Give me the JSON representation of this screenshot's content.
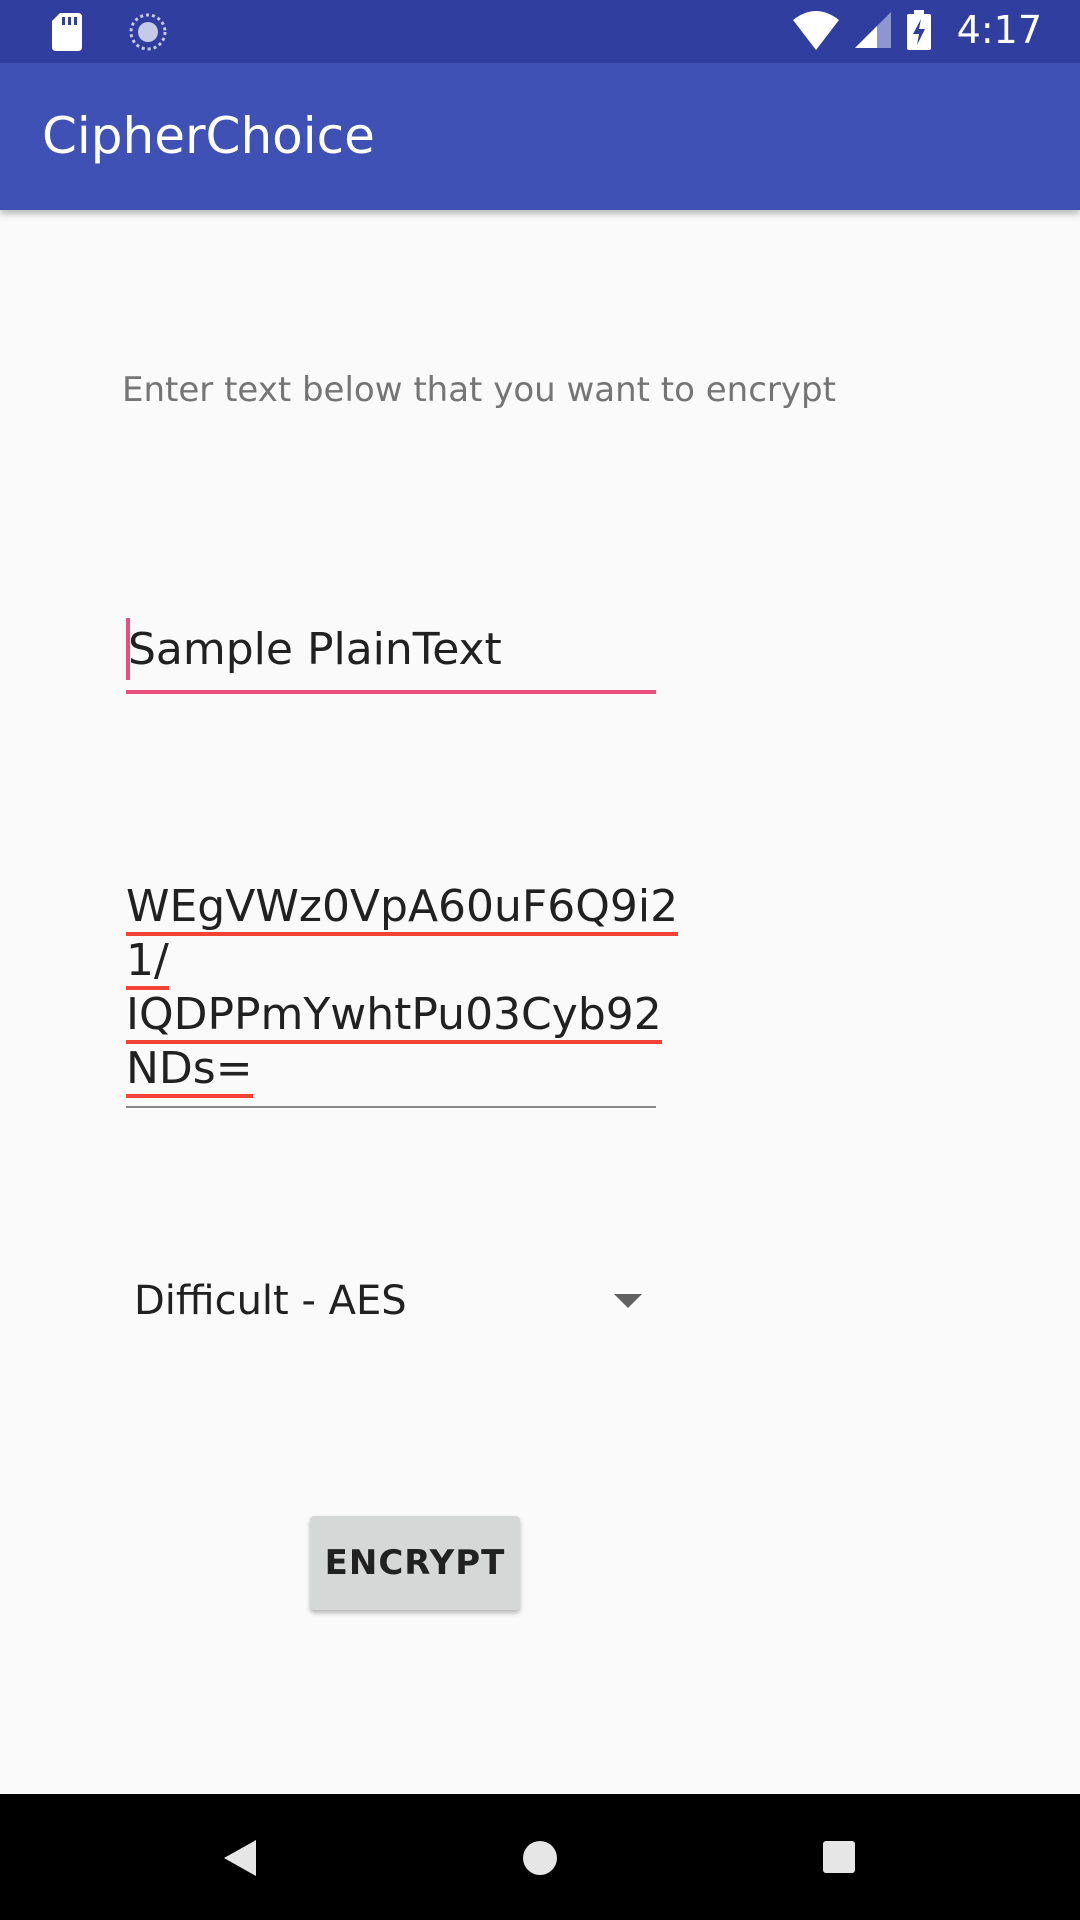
{
  "status_bar": {
    "time": "4:17",
    "icons": [
      "sd-card-icon",
      "sync-icon",
      "wifi-icon",
      "signal-icon",
      "battery-charging-icon"
    ]
  },
  "app_bar": {
    "title": "CipherChoice"
  },
  "main": {
    "prompt_label": "Enter text below that you want to encrypt",
    "plaintext_value": "Sample PlainText",
    "ciphertext_lines": [
      "WEgVWz0VpA60uF6Q9i2",
      "1/",
      "IQDPPmYwhtPu03Cyb92",
      "NDs="
    ],
    "cipher_selected": "Difficult - AES",
    "encrypt_label": "ENCRYPT"
  },
  "nav_bar": {
    "icons": [
      "back-icon",
      "home-icon",
      "recents-icon"
    ]
  },
  "colors": {
    "status_bar": "#303f9f",
    "app_bar": "#3f51b5",
    "accent": "#e94d7d",
    "spellcheck": "#f44336"
  }
}
